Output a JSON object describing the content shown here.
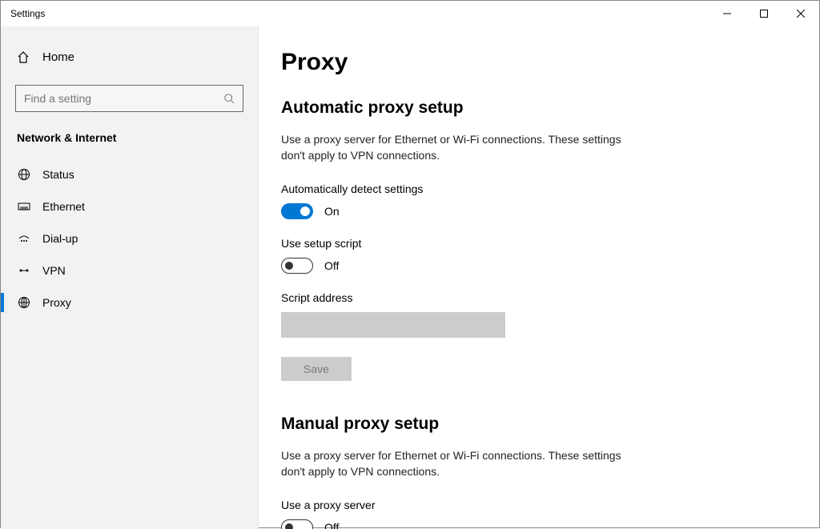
{
  "window": {
    "title": "Settings"
  },
  "sidebar": {
    "home_label": "Home",
    "search_placeholder": "Find a setting",
    "category": "Network & Internet",
    "items": [
      {
        "icon": "globe-grid-icon",
        "label": "Status"
      },
      {
        "icon": "ethernet-icon",
        "label": "Ethernet"
      },
      {
        "icon": "dialup-icon",
        "label": "Dial-up"
      },
      {
        "icon": "vpn-icon",
        "label": "VPN"
      },
      {
        "icon": "proxy-icon",
        "label": "Proxy"
      }
    ],
    "selected_index": 4
  },
  "main": {
    "page_title": "Proxy",
    "auto": {
      "title": "Automatic proxy setup",
      "desc": "Use a proxy server for Ethernet or Wi-Fi connections. These settings don't apply to VPN connections.",
      "detect_label": "Automatically detect settings",
      "detect_state": "On",
      "use_script_label": "Use setup script",
      "use_script_state": "Off",
      "script_address_label": "Script address",
      "script_address_value": "",
      "save_label": "Save"
    },
    "manual": {
      "title": "Manual proxy setup",
      "desc": "Use a proxy server for Ethernet or Wi-Fi connections. These settings don't apply to VPN connections.",
      "use_proxy_label": "Use a proxy server",
      "use_proxy_state": "Off"
    }
  }
}
